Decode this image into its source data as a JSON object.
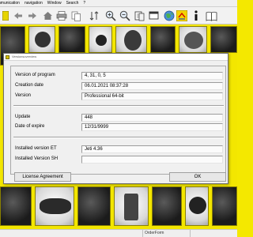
{
  "menubar": {
    "items": [
      "nmunication",
      "navigation",
      "Window",
      "Search",
      "?"
    ]
  },
  "toolbar": {
    "icons": [
      "yellow-square-icon",
      "back-arrow-icon",
      "forward-arrow-icon",
      "home-icon",
      "print-icon",
      "copy-icon",
      "sort-icon",
      "zoom-in-icon",
      "zoom-out-icon",
      "pages-icon",
      "window-icon",
      "globe-icon",
      "arrows-icon",
      "info-icon",
      "book-icon"
    ]
  },
  "colors": {
    "background_yellow": "#f3e600",
    "dialog_bg": "#f0f0f0"
  },
  "dialog": {
    "title": "Versionsoverview",
    "fields": [
      {
        "label": "Version of program",
        "value": "4, 31, 0, 5"
      },
      {
        "label": "Creation date",
        "value": "06.01.2021 08:37:28"
      },
      {
        "label": "Version",
        "value": "Professional 64-bit"
      },
      {
        "label": "Update",
        "value": "448"
      },
      {
        "label": "Date of expire",
        "value": "12/31/9999"
      },
      {
        "label": "Installed version ET",
        "value": "Jeti 4.36"
      },
      {
        "label": "Installed Version SH",
        "value": ""
      }
    ],
    "license_button": "License Agreement",
    "ok_button": "OK"
  },
  "statusbar": {
    "cells": [
      "",
      "OrderForm",
      ""
    ]
  }
}
